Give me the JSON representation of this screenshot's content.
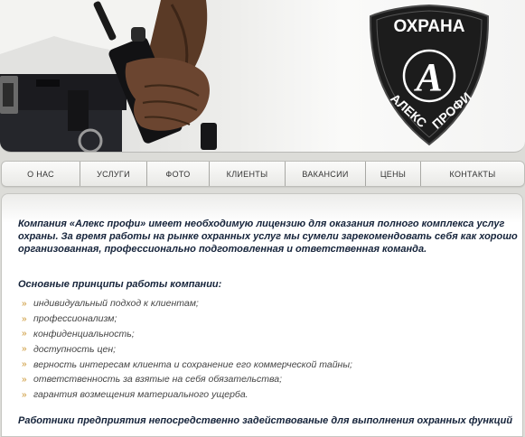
{
  "header": {
    "logo": {
      "top_text": "ОХРАНА",
      "monogram": "A",
      "left_text": "АЛЕКС",
      "right_text": "ПРОФИ"
    },
    "photo": {
      "subject": "security guard holding radio"
    }
  },
  "nav": {
    "items": [
      {
        "label": "О НАС"
      },
      {
        "label": "УСЛУГИ"
      },
      {
        "label": "ФОТО"
      },
      {
        "label": "КЛИЕНТЫ"
      },
      {
        "label": "ВАКАНСИИ"
      },
      {
        "label": "ЦЕНЫ"
      },
      {
        "label": "КОНТАКТЫ"
      }
    ]
  },
  "content": {
    "intro": "Компания «Алекс профи» имеет необходимую лицензию для оказания полного комплекса услуг охраны. За время работы на рынке охранных услуг мы сумели зарекомендовать себя как хорошо организованная, профессионально подготовленная и ответственная команда.",
    "principles_heading": "Основные принципы работы компании:",
    "bullet_glyph": "»",
    "principles": [
      "индивидуальный подход к клиентам;",
      "профессионализм;",
      "конфиденциальность;",
      "доступность цен;",
      "верность интересам клиента и сохранение его коммерческой тайны;",
      "ответственность за взятые на себя обязательства;",
      "гарантия возмещения материального ущерба."
    ],
    "workers_text": "Работники предприятия непосредственно задействованые для выполнения охранных функций"
  },
  "colors": {
    "text_dark": "#15233a",
    "bullet": "#c89028",
    "shield": "#1c1c1c"
  }
}
